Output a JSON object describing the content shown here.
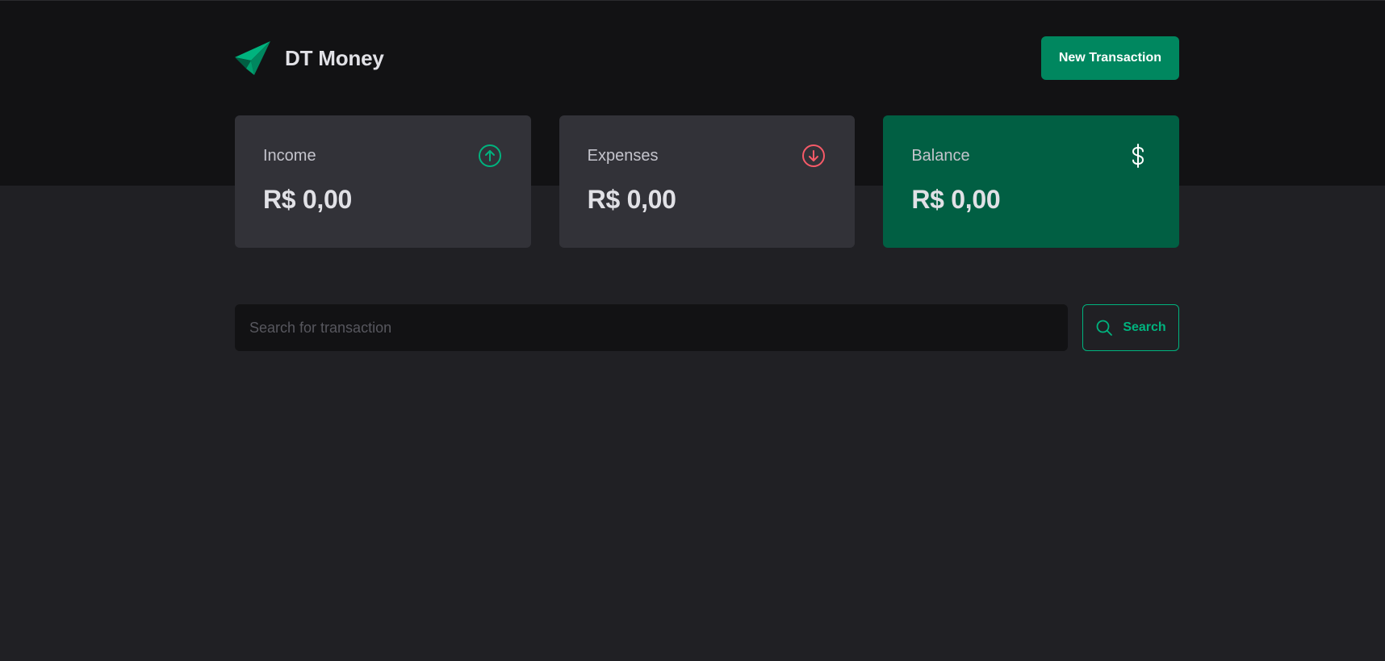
{
  "header": {
    "brand_name": "DT Money",
    "logo_icon": "paper-plane-logo",
    "new_transaction_label": "New Transaction"
  },
  "summary": {
    "income": {
      "label": "Income",
      "value": "R$ 0,00",
      "icon": "arrow-circle-up-icon",
      "color": "#00b37e"
    },
    "expenses": {
      "label": "Expenses",
      "value": "R$ 0,00",
      "icon": "arrow-circle-down-icon",
      "color": "#f75a68"
    },
    "balance": {
      "label": "Balance",
      "value": "R$ 0,00",
      "icon": "currency-dollar-icon",
      "color": "#015f43"
    }
  },
  "search": {
    "placeholder": "Search for transaction",
    "value": "",
    "button_label": "Search"
  },
  "colors": {
    "brand": "#00875f",
    "accent": "#00b37e",
    "background": "#202024",
    "header_background": "#121214",
    "card_background": "#323238"
  }
}
